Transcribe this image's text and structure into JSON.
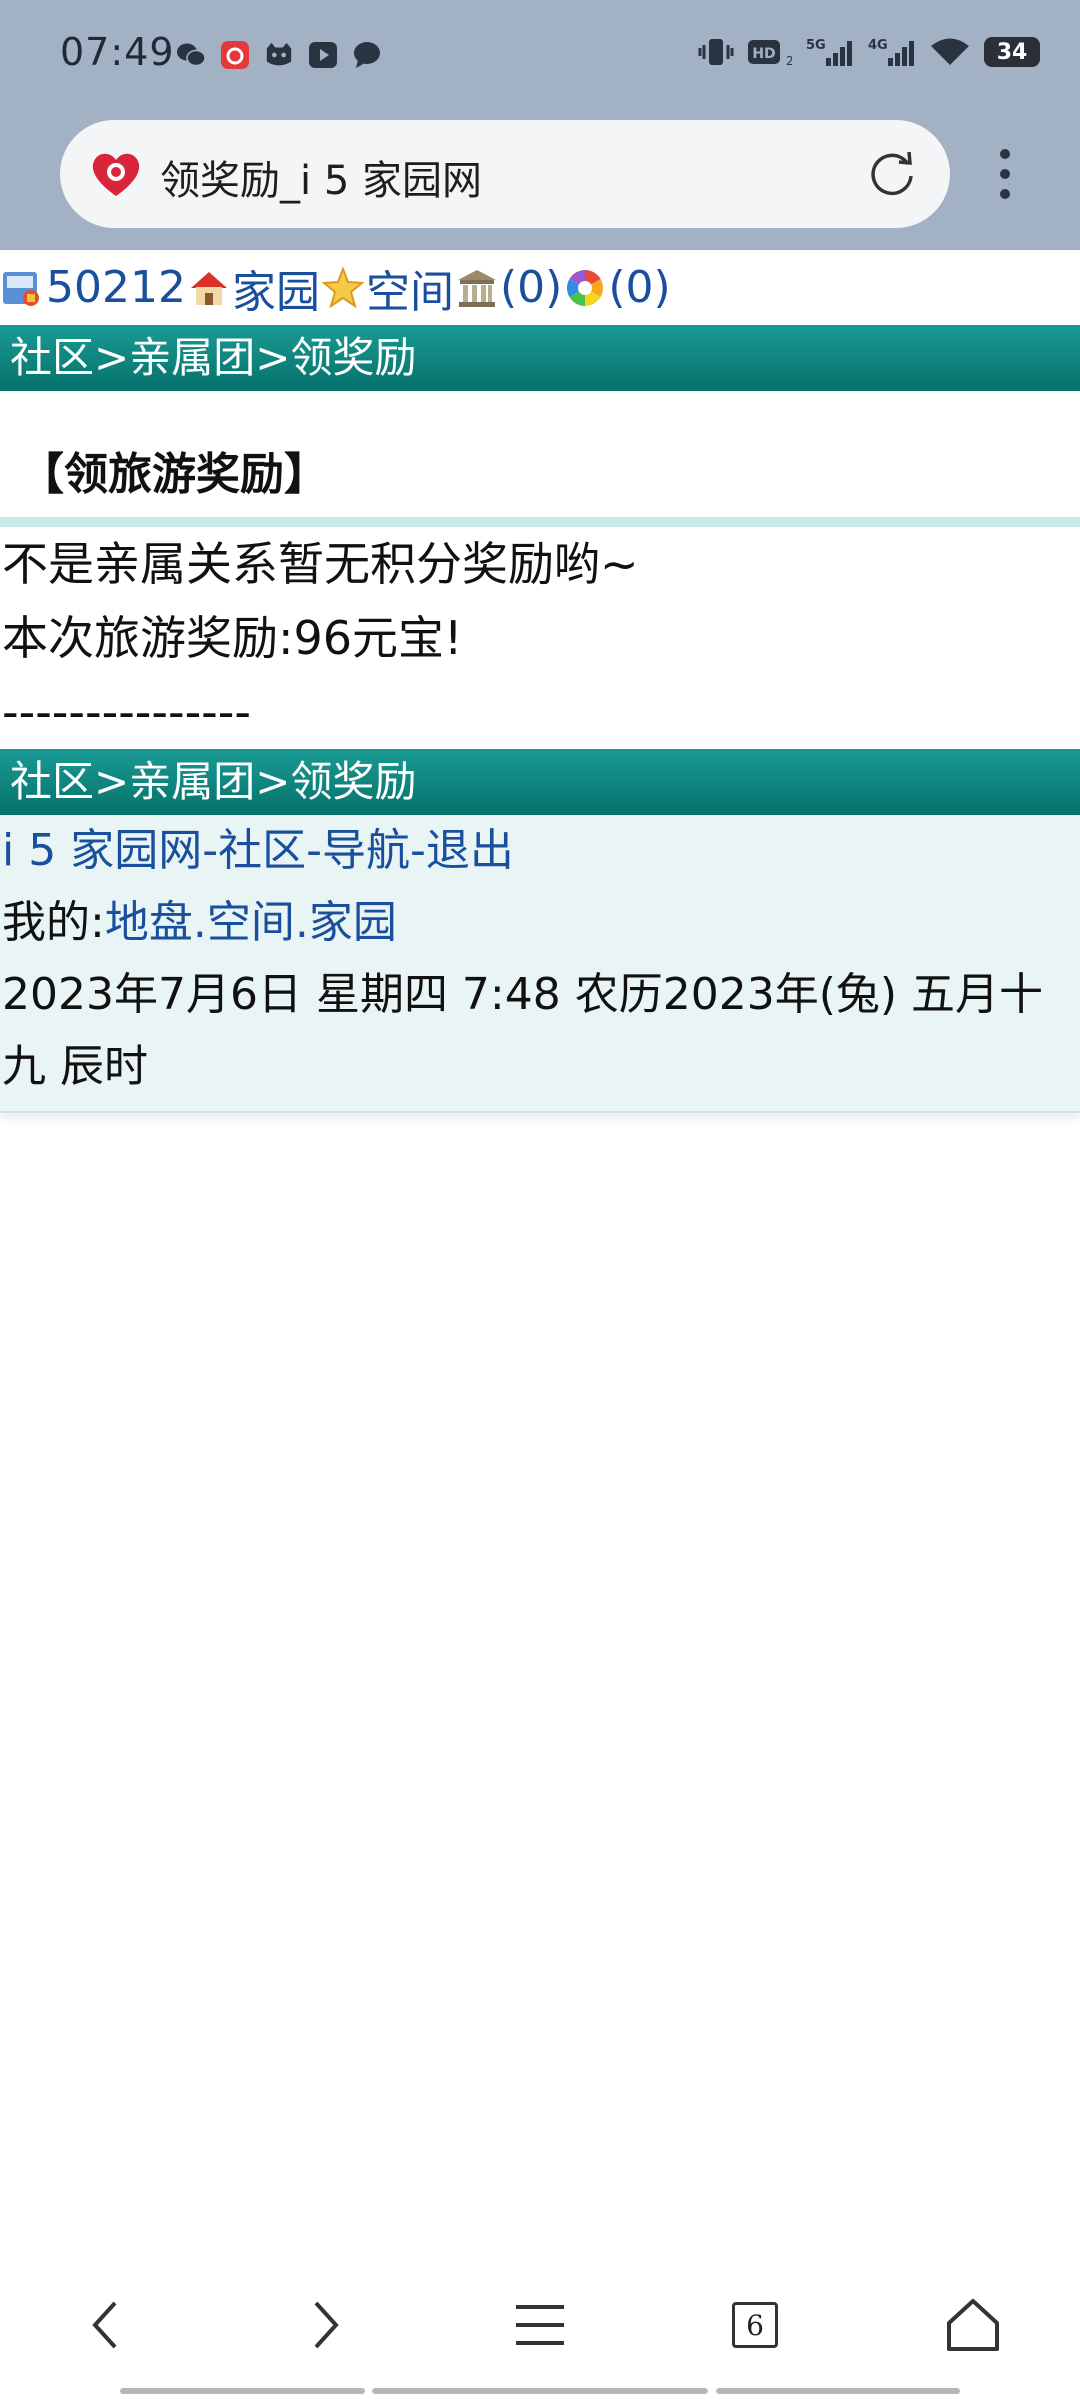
{
  "status": {
    "time": "07:49",
    "network_hd": "HD",
    "network_5g": "5G",
    "network_4g": "4G",
    "battery": "34"
  },
  "browser": {
    "page_title": "领奖励_i 5 家园网",
    "tab_count": "6"
  },
  "user_bar": {
    "user_id": "50212",
    "home_link": "家园",
    "space_link": "空间",
    "count_a": "(0)",
    "count_b": "(0)"
  },
  "breadcrumb": {
    "community": "社区",
    "sep1": ">",
    "group": "亲属团",
    "sep2": ">",
    "current": "领奖励"
  },
  "section": {
    "title": "【领旅游奖励】",
    "line1": "不是亲属关系暂无积分奖励哟~",
    "line2": "本次旅游奖励:96元宝!",
    "divider": "---------------"
  },
  "footer": {
    "site_link": "i 5 家园网",
    "dash1": "-",
    "community_link": "社区",
    "dash2": "-",
    "nav_link": "导航",
    "dash3": "-",
    "logout_link": "退出",
    "mine_label": "我的:",
    "land_link": "地盘",
    "dot1": ".",
    "space_link": "空间",
    "dot2": ".",
    "home_link": "家园",
    "datetime": "2023年7月6日  星期四  7:48  农历2023年(兔)  五月十九  辰时"
  },
  "colors": {
    "chrome_bg": "#a3b1c5",
    "nav_teal": "#0a7f79",
    "link_blue": "#1a4f9e",
    "footer_bg": "#e9f4f5"
  }
}
